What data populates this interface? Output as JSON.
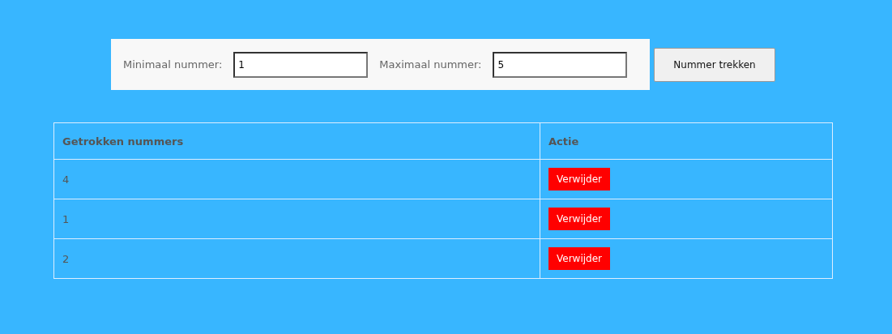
{
  "form": {
    "fields": [
      {
        "label": "Minimaal nummer:",
        "value": "1"
      },
      {
        "label": "Maximaal nummer:",
        "value": "5"
      }
    ],
    "button": "Nummer trekken"
  },
  "table": {
    "columns": [
      "Getrokken nummers",
      "Actie"
    ],
    "rows": [
      {
        "number": "4",
        "action": "Verwijder"
      },
      {
        "number": "1",
        "action": "Verwijder"
      },
      {
        "number": "2",
        "action": "Verwijder"
      }
    ]
  }
}
